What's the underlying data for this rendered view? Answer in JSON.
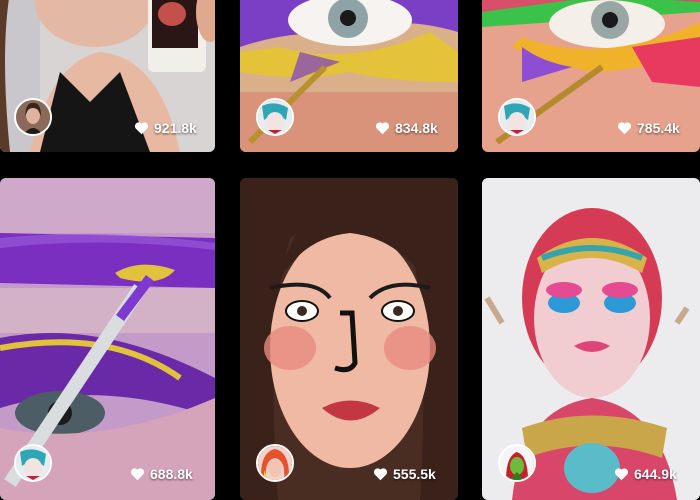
{
  "feed": {
    "videos": [
      {
        "likes": "921.8k",
        "creator_avatar": "avatar-woman-brown-hair",
        "thumbnail": "woman-holding-bottle"
      },
      {
        "likes": "834.8k",
        "creator_avatar": "avatar-teal-makeup",
        "thumbnail": "purple-yellow-eye-makeup"
      },
      {
        "likes": "785.4k",
        "creator_avatar": "avatar-teal-makeup",
        "thumbnail": "rainbow-eyeliner"
      },
      {
        "likes": "688.8k",
        "creator_avatar": "avatar-teal-makeup",
        "thumbnail": "purple-gold-eyeshadow"
      },
      {
        "likes": "555.5k",
        "creator_avatar": "avatar-rainbow-hair",
        "thumbnail": "cartoon-face-makeup"
      },
      {
        "likes": "644.9k",
        "creator_avatar": "avatar-green-character",
        "thumbnail": "pink-body-paint"
      }
    ]
  },
  "colors": {
    "background": "#000000",
    "text": "#ffffff"
  },
  "icons": {
    "like": "heart-icon"
  }
}
